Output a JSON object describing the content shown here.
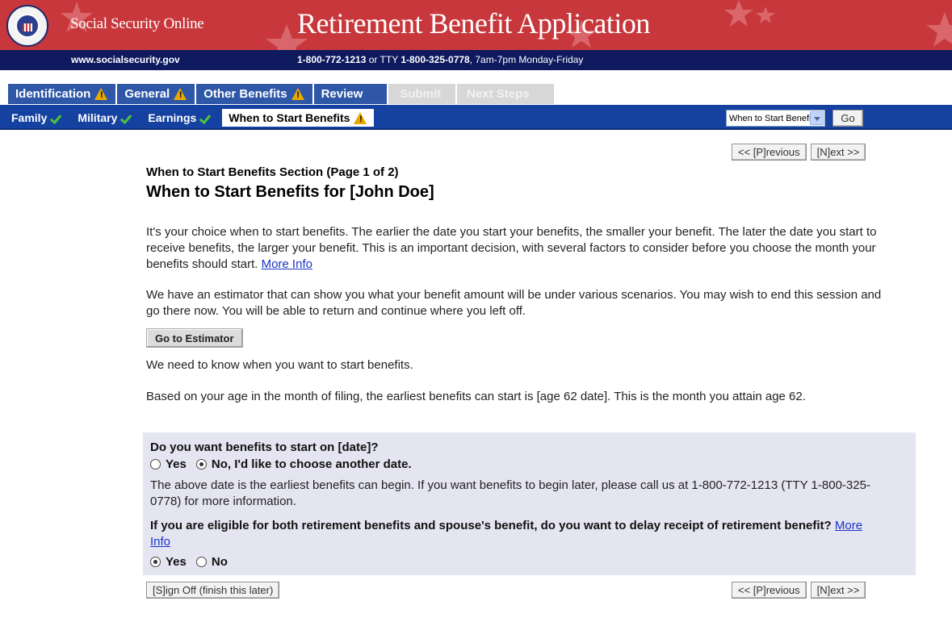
{
  "banner": {
    "site_name": "Social Security Online",
    "app_title": "Retirement Benefit Application",
    "url": "www.socialsecurity.gov",
    "phone_main": "1-800-772-1213",
    "phone_or": " or TTY ",
    "phone_tty": "1-800-325-0778",
    "hours": ", 7am-7pm Monday-Friday"
  },
  "tabs": [
    {
      "label": "Identification",
      "warning": true,
      "state": "normal"
    },
    {
      "label": "General",
      "warning": true,
      "state": "active"
    },
    {
      "label": "Other Benefits",
      "warning": true,
      "state": "normal"
    },
    {
      "label": "Review",
      "warning": false,
      "state": "normal"
    },
    {
      "label": "Submit",
      "warning": false,
      "state": "disabled"
    },
    {
      "label": "Next Steps",
      "warning": false,
      "state": "disabled"
    }
  ],
  "subnav": {
    "items": [
      {
        "label": "Family",
        "status": "complete"
      },
      {
        "label": "Military",
        "status": "complete"
      },
      {
        "label": "Earnings",
        "status": "complete"
      },
      {
        "label": "When to Start Benefits",
        "status": "warning"
      }
    ],
    "jump_select_value": "When to Start Benefits",
    "go_label": "Go"
  },
  "nav": {
    "previous": "<< [P]revious",
    "next": "[N]ext >>",
    "sign_off": "[S]ign Off (finish this later)"
  },
  "content": {
    "section_label": "When to Start Benefits Section (Page 1 of 2)",
    "title": "When to Start Benefits for [John Doe]",
    "p1": "It's your choice when to start benefits. The earlier the date you start your benefits, the smaller your benefit. The later the date you start to receive benefits, the larger your benefit. This is an important decision, with several factors to consider before you choose the month your benefits should start. ",
    "more_info": "More Info",
    "p2": "We have an estimator that can show you what your benefit amount will be under various scenarios. You may wish to end this session and go there now. You will be able to return and continue where you left off.",
    "estimator_button": "Go to Estimator",
    "p3": "We need to know when you want to start benefits.",
    "p4": "Based on your age in the month of filing, the earliest benefits can start is [age 62 date]. This is the month you attain age 62."
  },
  "questions": {
    "q1": "Do you want benefits to start on [date]?",
    "q1_options": [
      {
        "label": "Yes",
        "selected": false
      },
      {
        "label": "No, I'd like to choose another date.",
        "selected": true
      }
    ],
    "q1_note": "The above date is the earliest benefits can begin. If you want benefits to begin later, please call us at 1-800-772-1213 (TTY 1-800-325-0778) for more information.",
    "q2": "If you are eligible for both retirement benefits and spouse's benefit, do you want to delay receipt of retirement benefit? ",
    "q2_more_info": "More Info",
    "q2_options": [
      {
        "label": "Yes",
        "selected": true
      },
      {
        "label": "No",
        "selected": false
      }
    ]
  },
  "colors": {
    "banner_red": "#c8373b",
    "navy": "#0f1a5e",
    "tab_blue": "#2e57a8",
    "subnav_blue": "#1542a0",
    "warning": "#e8a800",
    "check": "#4dc33b",
    "question_bg": "#e5e5f1",
    "link": "#1a33c8"
  }
}
